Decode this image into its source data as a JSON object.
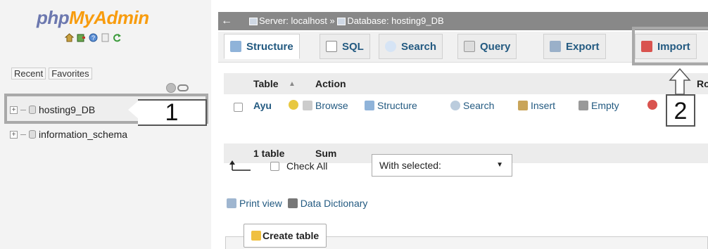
{
  "sidebar": {
    "logo_part1": "php",
    "logo_part2": "MyAdmin",
    "nav_icons": [
      "home-icon",
      "exit-icon",
      "help-icon",
      "docs-icon",
      "reload-icon"
    ],
    "tabs": [
      "Recent",
      "Favorites"
    ],
    "databases": [
      {
        "name": "hosting9_DB"
      },
      {
        "name": "information_schema"
      }
    ]
  },
  "header": {
    "back": "←",
    "breadcrumb_server": "Server: localhost",
    "breadcrumb_sep": "»",
    "breadcrumb_db": "Database: hosting9_DB"
  },
  "tabs": [
    {
      "label": "Structure",
      "icon": "structure-icon",
      "active": true
    },
    {
      "label": "SQL",
      "icon": "sql-icon"
    },
    {
      "label": "Search",
      "icon": "search-icon"
    },
    {
      "label": "Query",
      "icon": "query-icon"
    },
    {
      "label": "Export",
      "icon": "export-icon"
    },
    {
      "label": "Import",
      "icon": "import-icon"
    }
  ],
  "table": {
    "headers": {
      "table": "Table",
      "sort_indicator": "▲",
      "action": "Action",
      "rows": "Ro"
    },
    "row": {
      "name": "Ayu",
      "actions": [
        "Browse",
        "Structure",
        "Search",
        "Insert",
        "Empty"
      ]
    },
    "footer": {
      "count": "1 table",
      "sum": "Sum"
    }
  },
  "bulk": {
    "check_all": "Check All",
    "with_selected": "With selected:",
    "caret": "▼"
  },
  "links": {
    "print_view": "Print view",
    "data_dictionary": "Data Dictionary"
  },
  "create_table": "Create table",
  "callouts": {
    "one": "1",
    "two": "2"
  },
  "colors": {
    "logo_blue": "#6c78af",
    "logo_orange": "#f89c0e",
    "link": "#235a81",
    "highlight_border": "#a9a9a9"
  }
}
